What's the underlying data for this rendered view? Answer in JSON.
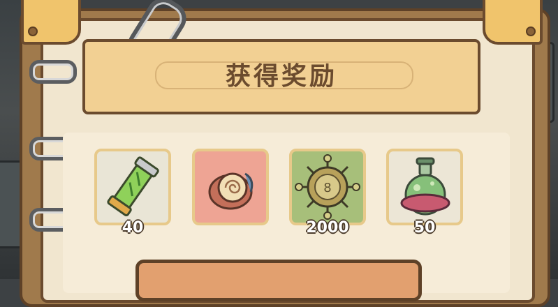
{
  "panel": {
    "title": "获得奖励"
  },
  "rewards": [
    {
      "item": "green-scroll-tube",
      "count": "40"
    },
    {
      "item": "spiral-shell",
      "count": ""
    },
    {
      "item": "bronze-disc-relic",
      "count": "2000"
    },
    {
      "item": "potion-flask",
      "count": "50"
    }
  ],
  "colors": {
    "banner": "#f2d093",
    "page": "#f1e6cf",
    "border": "#6b4b2e",
    "slot_green": "#a7bf7a",
    "slot_red": "#eea494"
  }
}
